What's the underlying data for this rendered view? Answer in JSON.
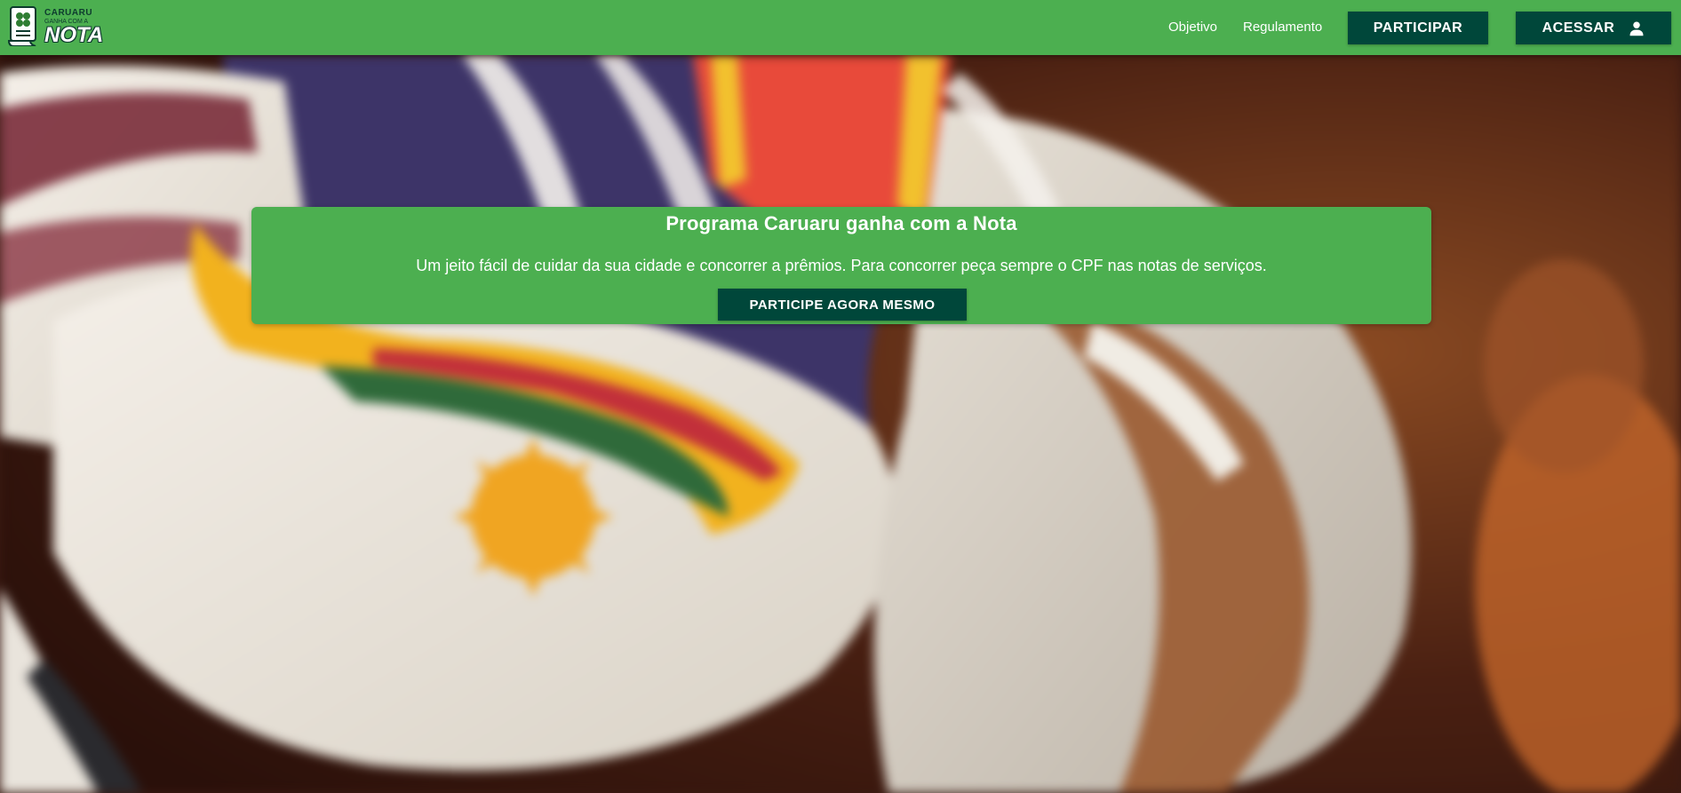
{
  "header": {
    "logo": {
      "line1": "CARUARU",
      "line2": "GANHA COM A",
      "line3": "NOTA"
    },
    "nav": {
      "objetivo": "Objetivo",
      "regulamento": "Regulamento"
    },
    "participar_label": "PARTICIPAR",
    "acessar_label": "ACESSAR",
    "acessar_icon": "user-icon"
  },
  "hero": {
    "title": "Programa Caruaru ganha com a Nota",
    "subtitle": "Um jeito fácil de cuidar da sua cidade e concorrer a prêmios. Para concorrer peça sempre o CPF nas notas de serviços.",
    "cta_label": "PARTICIPE AGORA MESMO"
  },
  "colors": {
    "brand_green": "#4caf50",
    "dark_green": "#00473a"
  }
}
